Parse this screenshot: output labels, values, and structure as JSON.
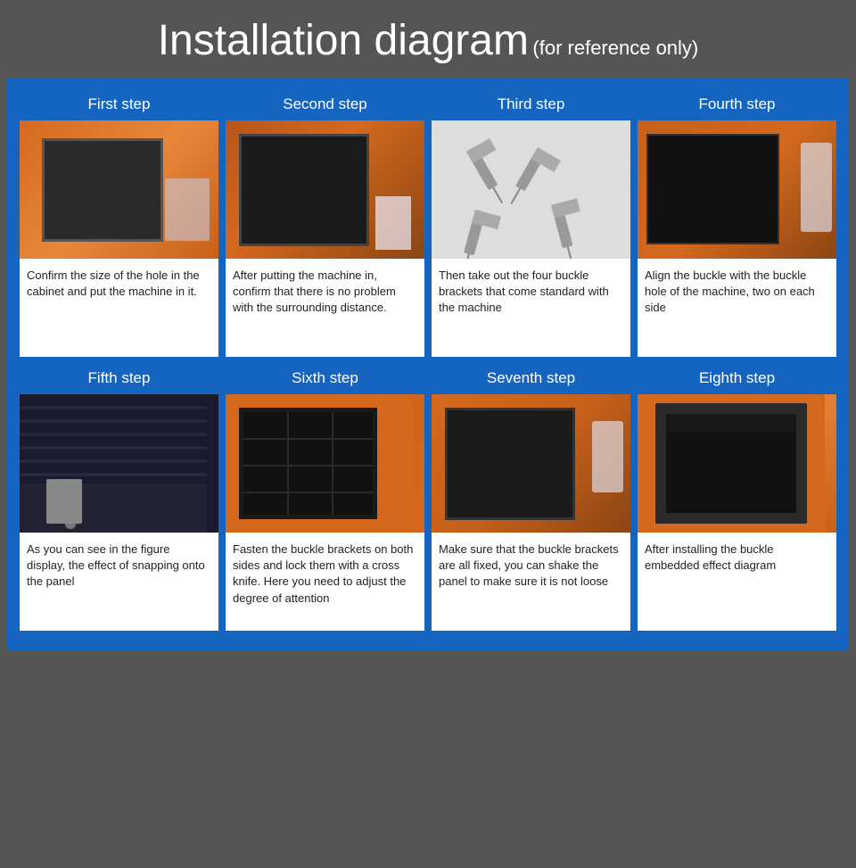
{
  "page": {
    "title": "Installation diagram",
    "subtitle": "(for reference only)",
    "background_color": "#555555",
    "main_bg": "#1565c0"
  },
  "rows": [
    {
      "steps": [
        {
          "id": "step1",
          "title": "First step",
          "description": "Confirm the size of the hole in the cabinet and put the machine in it."
        },
        {
          "id": "step2",
          "title": "Second step",
          "description": "After putting the machine in, confirm that there is no problem with the surrounding distance."
        },
        {
          "id": "step3",
          "title": "Third step",
          "description": "Then take out the four buckle brackets that come standard with the machine"
        },
        {
          "id": "step4",
          "title": "Fourth step",
          "description": "Align the buckle with the buckle hole of the machine, two on each side"
        }
      ]
    },
    {
      "steps": [
        {
          "id": "step5",
          "title": "Fifth step",
          "description": "As you can see in the figure display, the effect of snapping onto the panel"
        },
        {
          "id": "step6",
          "title": "Sixth step",
          "description": "Fasten the buckle brackets on both sides and lock them with a cross knife. Here you need to adjust the degree of attention"
        },
        {
          "id": "step7",
          "title": "Seventh step",
          "description": "Make sure that the buckle brackets are all fixed, you can shake the panel to make sure it is not loose"
        },
        {
          "id": "step8",
          "title": "Eighth step",
          "description": "After installing the buckle embedded effect diagram"
        }
      ]
    }
  ]
}
